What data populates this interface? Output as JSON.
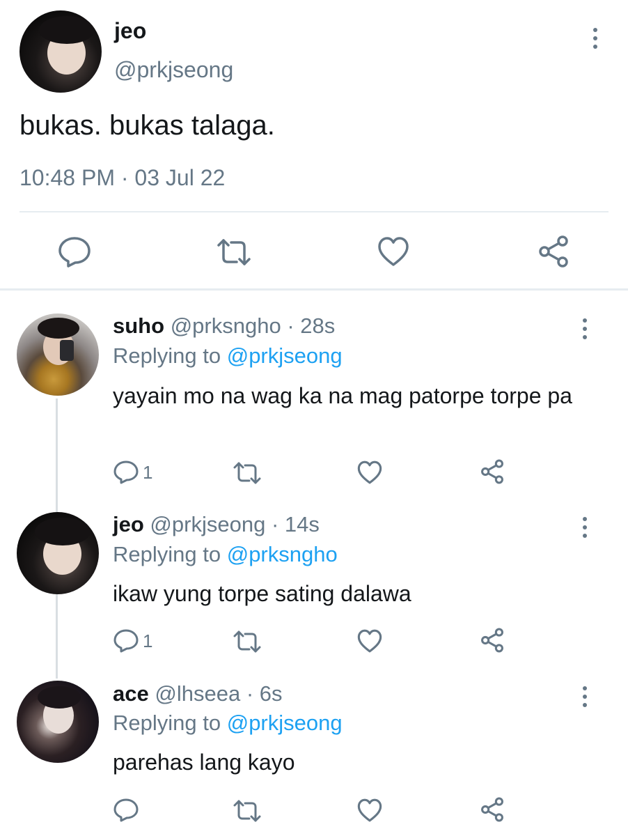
{
  "tweet": {
    "name": "jeo",
    "handle": "@prkjseong",
    "text": "bukas. bukas talaga.",
    "timestamp": "10:48 PM · 03 Jul 22",
    "actions": [
      "reply-icon",
      "retweet-icon",
      "like-icon",
      "share-icon"
    ]
  },
  "replies": [
    {
      "name": "suho",
      "handle": "@prksngho",
      "time": "· 28s",
      "replying_prefix": "Replying to",
      "replying_to": "@prkjseong",
      "text": "yayain mo na wag ka na mag patorpe torpe pa",
      "reply_count": "1"
    },
    {
      "name": "jeo",
      "handle": "@prkjseong",
      "time": "· 14s",
      "replying_prefix": "Replying to",
      "replying_to": "@prksngho",
      "text": "ikaw yung torpe sating dalawa",
      "reply_count": "1"
    },
    {
      "name": "ace",
      "handle": "@lhseea",
      "time": "· 6s",
      "replying_prefix": "Replying to",
      "replying_to": "@prkjseong",
      "text": "parehas lang kayo",
      "reply_count": ""
    }
  ],
  "colors": {
    "text": "#14171a",
    "secondary": "#657786",
    "link": "#1da1f2",
    "divider": "#e6ecf0"
  }
}
